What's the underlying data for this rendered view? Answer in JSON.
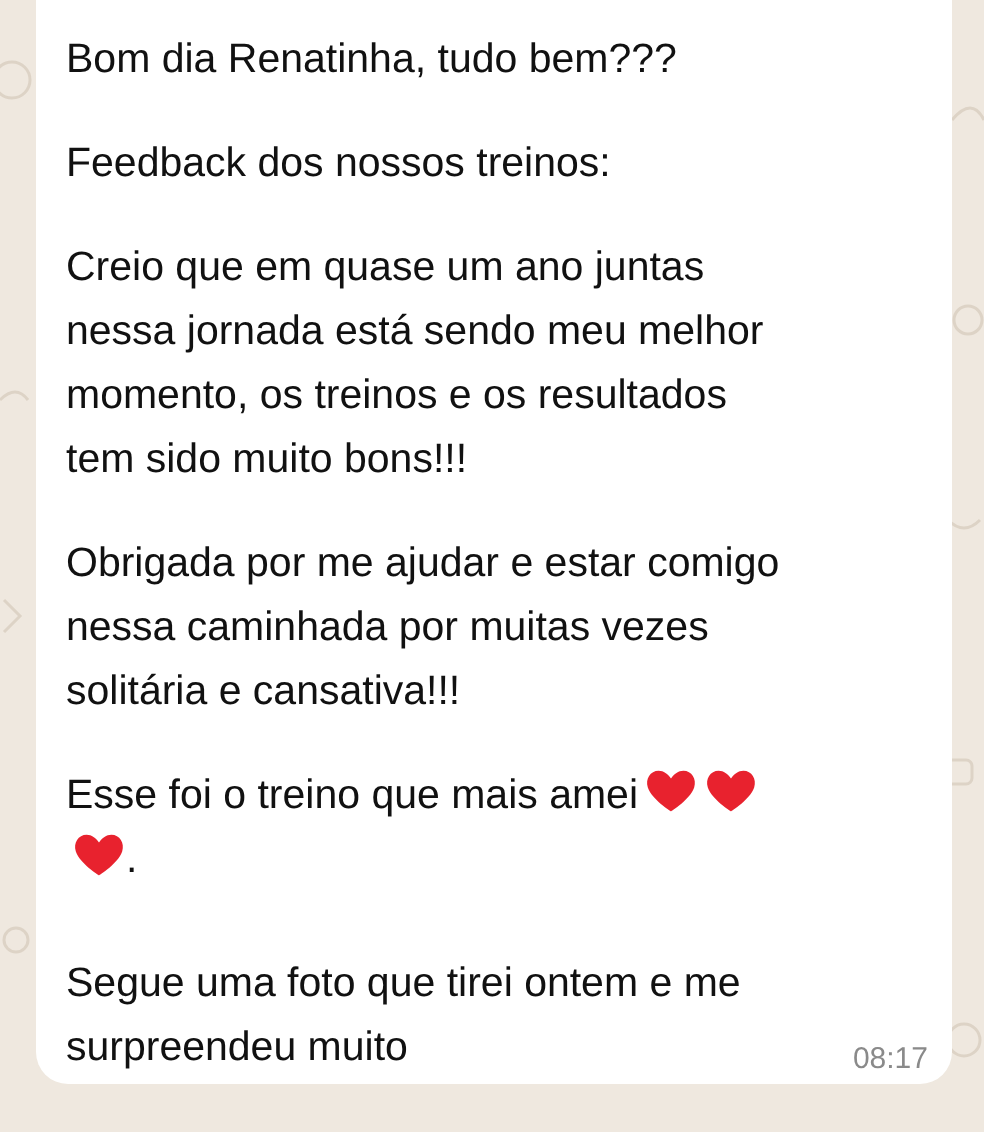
{
  "message": {
    "paragraphs": [
      "Bom dia Renatinha, tudo bem???",
      "Feedback dos nossos treinos:",
      "Creio que em quase um ano juntas nessa jornada está sendo meu melhor momento, os treinos e os resultados tem sido muito bons!!!",
      "Obrigada por me ajudar e estar comigo nessa caminhada por muitas vezes solitária e cansativa!!!"
    ],
    "favorite": {
      "text": "Esse foi o treino que mais amei",
      "trailing": "."
    },
    "caption": {
      "text": "Segue uma foto que tirei ontem e me surpreendeu muito",
      "time": "08:17"
    }
  }
}
